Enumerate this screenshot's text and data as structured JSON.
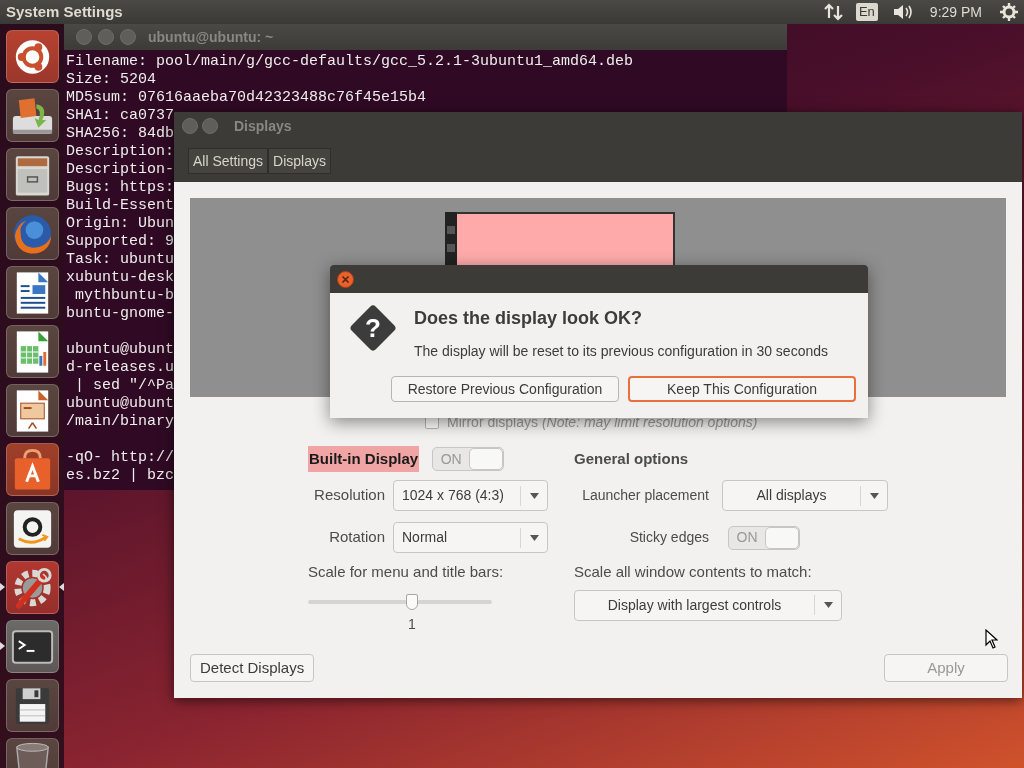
{
  "top_panel": {
    "app_title": "System Settings",
    "keyboard_layout": "En",
    "clock": "9:29 PM"
  },
  "launcher": {
    "items": [
      {
        "kind": "dash",
        "running": false,
        "focused": false
      },
      {
        "kind": "installer",
        "running": false,
        "focused": false
      },
      {
        "kind": "files",
        "running": false,
        "focused": false
      },
      {
        "kind": "browser",
        "running": false,
        "focused": false
      },
      {
        "kind": "writer",
        "running": false,
        "focused": false
      },
      {
        "kind": "calc",
        "running": false,
        "focused": false
      },
      {
        "kind": "impress",
        "running": false,
        "focused": false
      },
      {
        "kind": "store",
        "running": false,
        "focused": false
      },
      {
        "kind": "shop",
        "running": false,
        "focused": false
      },
      {
        "kind": "settings",
        "running": true,
        "focused": true
      },
      {
        "kind": "terminal",
        "running": true,
        "focused": false
      },
      {
        "kind": "disk",
        "running": false,
        "focused": false
      },
      {
        "kind": "trash",
        "running": false,
        "focused": false
      }
    ]
  },
  "terminal": {
    "title": "ubuntu@ubuntu: ~",
    "blocks": [
      [
        "Filename: pool/main/g/gcc-defaults/gcc_5.2.1-3ubuntu1_amd64.deb",
        "Size: 5204",
        "MD5sum: 07616aaeba70d42323488c76f45e15b4",
        "SHA1: ca0737",
        "SHA256: 84db",
        "Description:",
        "Description-",
        "Bugs: https:",
        "Build-Essent",
        "Origin: Ubun",
        "Supported: 9",
        "Task: ubuntu",
        "xubuntu-desk",
        " mythbuntu-b",
        "buntu-gnome-"
      ],
      [
        "ubuntu@ubunt",
        "d-releases.u",
        " | sed \"/^Pa",
        "ubuntu@ubunt",
        "/main/binary"
      ],
      [
        "-qO- http://",
        "es.bz2 | bzc"
      ]
    ]
  },
  "displays_window": {
    "title": "Displays",
    "breadcrumbs": [
      "All Settings",
      "Displays"
    ],
    "mirror": {
      "label": "Mirror displays *(Note: may limit resolution options)*",
      "checked": false
    },
    "builtin_display": {
      "label": "Built-in Display",
      "switch": {
        "text": "ON",
        "on": true
      }
    },
    "resolution": {
      "label": "Resolution",
      "value": "1024 x 768 (4:3)"
    },
    "rotation": {
      "label": "Rotation",
      "value": "Normal"
    },
    "scale_menu": {
      "label": "Scale for menu and title bars:",
      "level": 0.565,
      "reading": "1"
    },
    "general_options": {
      "heading": "General options",
      "launcher_placement": {
        "label": "Launcher placement",
        "value": "All displays"
      },
      "sticky_edges": {
        "label": "Sticky edges",
        "switch": {
          "text": "ON",
          "on": true
        }
      },
      "scale_all": {
        "label": "Scale all window contents to match:",
        "value": "Display with largest controls"
      }
    },
    "buttons": [
      {
        "label": "Detect Displays",
        "disabled": false
      },
      {
        "label": "Apply",
        "disabled": true
      }
    ]
  },
  "dialog": {
    "icon_glyph": "?",
    "heading": "Does the display look OK?",
    "message": "The display will be reset to its previous configuration in 30 seconds",
    "buttons": [
      {
        "label": "Restore Previous Configuration",
        "focused": false
      },
      {
        "label": "Keep This Configuration",
        "focused": true
      }
    ]
  }
}
